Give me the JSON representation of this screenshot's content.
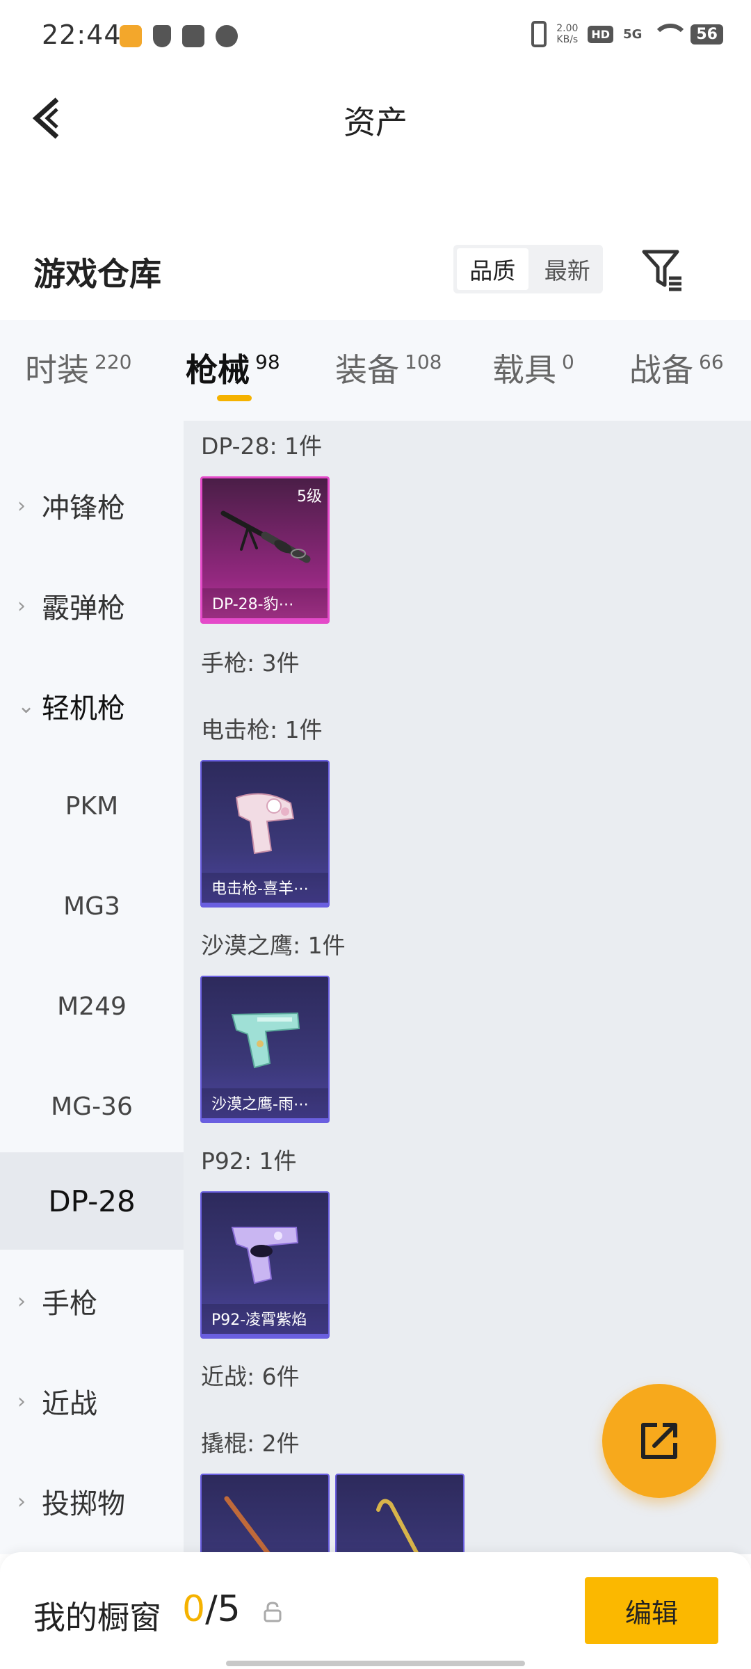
{
  "status_bar": {
    "time": "22:44",
    "net_speed_value": "2.00",
    "net_speed_unit": "KB/s",
    "hd": "HD",
    "signal": "5G",
    "battery": "56"
  },
  "nav": {
    "title": "资产"
  },
  "warehouse": {
    "title": "游戏仓库",
    "sort_options": [
      "品质",
      "最新"
    ],
    "sort_selected": "品质"
  },
  "tabs": [
    {
      "label": "时装",
      "count": "220"
    },
    {
      "label": "枪械",
      "count": "98"
    },
    {
      "label": "装备",
      "count": "108"
    },
    {
      "label": "载具",
      "count": "0"
    },
    {
      "label": "战备",
      "count": "66"
    }
  ],
  "active_tab": "枪械",
  "sidebar": {
    "categories": [
      {
        "label": "冲锋枪"
      },
      {
        "label": "霰弹枪"
      },
      {
        "label": "轻机枪"
      },
      {
        "label": "手枪"
      },
      {
        "label": "近战"
      },
      {
        "label": "投掷物"
      }
    ],
    "subitems": [
      {
        "label": "PKM"
      },
      {
        "label": "MG3"
      },
      {
        "label": "M249"
      },
      {
        "label": "MG-36"
      },
      {
        "label": "DP-28"
      }
    ],
    "selected_subitem": "DP-28"
  },
  "content": {
    "groups": [
      {
        "label": "DP-28: 1件"
      },
      {
        "label": "手枪: 3件"
      },
      {
        "label": "电击枪: 1件"
      },
      {
        "label": "沙漠之鹰: 1件"
      },
      {
        "label": "P92: 1件"
      },
      {
        "label": "近战: 6件"
      },
      {
        "label": "撬棍: 2件"
      }
    ],
    "cards": [
      {
        "name": "DP-28-豹⋯",
        "level": "5级",
        "rarity": "pink",
        "icon": "machine-gun"
      },
      {
        "name": "电击枪-喜羊⋯",
        "rarity": "purple",
        "icon": "stun-gun"
      },
      {
        "name": "沙漠之鹰-雨⋯",
        "rarity": "purple",
        "icon": "pistol"
      },
      {
        "name": "P92-凌霄紫焰",
        "rarity": "purple",
        "icon": "pistol"
      },
      {
        "name": "",
        "rarity": "purple",
        "icon": "crowbar"
      },
      {
        "name": "",
        "rarity": "purple",
        "icon": "crowbar"
      }
    ]
  },
  "bottom_bar": {
    "label": "我的橱窗",
    "current": "0",
    "total": "/5",
    "edit_label": "编辑"
  },
  "colors": {
    "accent": "#f5b200",
    "fab": "#f7a91c",
    "rarity_pink": "#e44ac9",
    "rarity_purple": "#6a5fe0"
  }
}
